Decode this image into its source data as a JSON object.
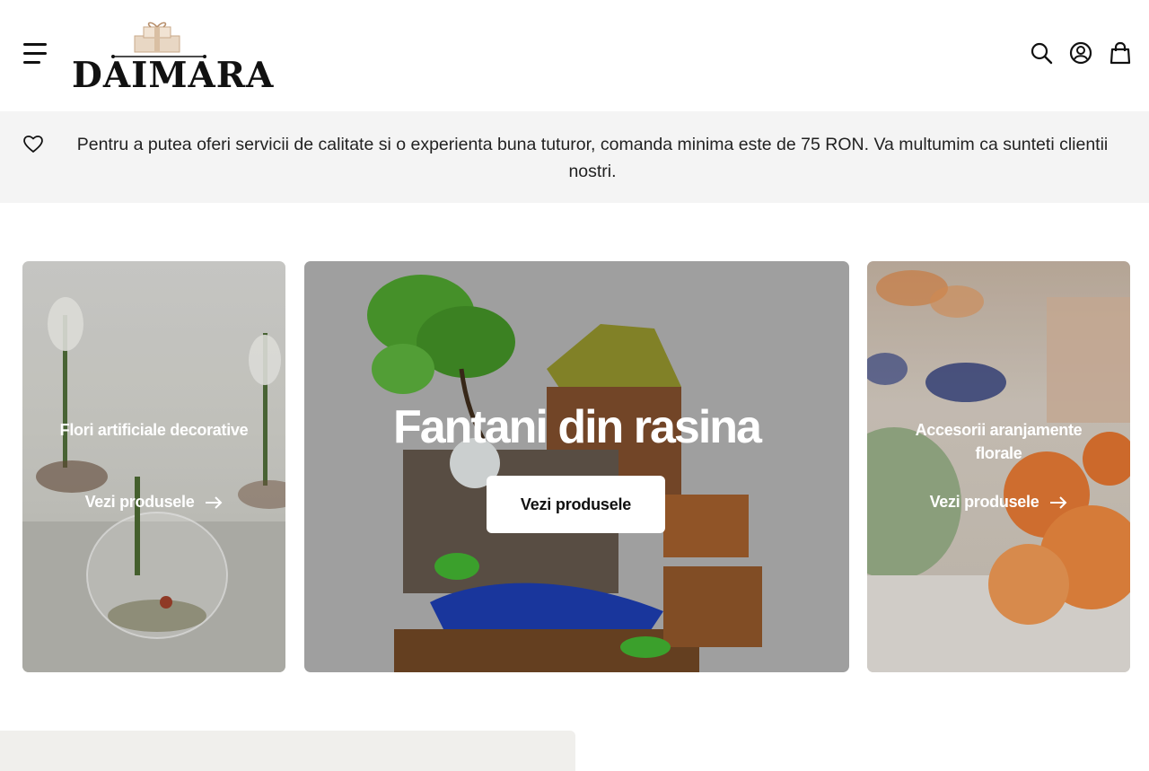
{
  "header": {
    "brand": "DAIMARA",
    "icons": [
      "menu-icon",
      "search-icon",
      "account-icon",
      "cart-icon"
    ]
  },
  "announcement": {
    "icon": "heart-icon",
    "text": "Pentru a putea oferi servicii de calitate si o experienta buna tuturor, comanda minima este de 75 RON. Va multumim ca sunteti clientii nostri."
  },
  "cards": [
    {
      "title": "Flori artificiale decorative",
      "link_label": "Vezi produsele"
    },
    {
      "title": "Fantani din rasina",
      "button_label": "Vezi produsele"
    },
    {
      "title": "Accesorii aranjamente florale",
      "link_label": "Vezi produsele"
    }
  ],
  "colors": {
    "text": "#111111",
    "announcement_bg": "#f4f4f4",
    "card_overlay_mid": "#a9a9a9",
    "button_bg": "#ffffff",
    "bottom_block": "#f0efec"
  }
}
